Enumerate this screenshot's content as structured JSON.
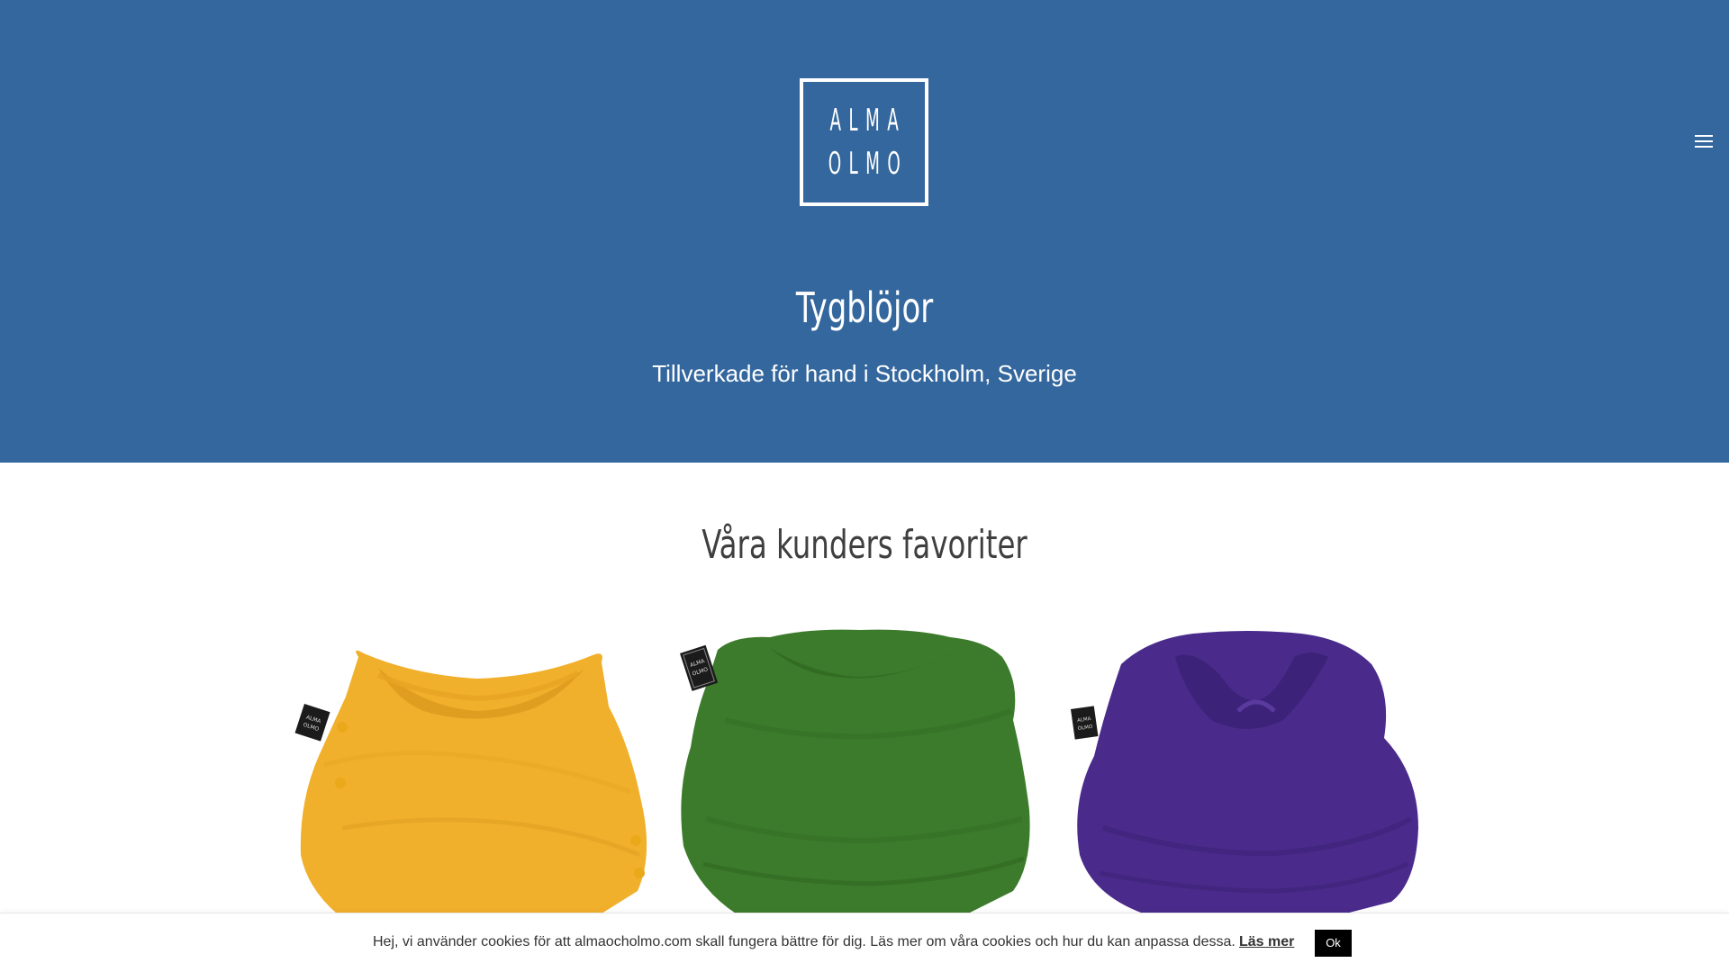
{
  "header": {
    "logo": {
      "line1": "ALMA",
      "line2": "OLMO"
    },
    "menu_icon": "hamburger-menu-icon",
    "title": "Tygblöjor",
    "subtitle": "Tillverkade för hand i Stockholm, Sverige",
    "background_color": "#34679d"
  },
  "favorites": {
    "title": "Våra kunders favoriter",
    "products": [
      {
        "color_name": "yellow",
        "color": "#f2b32a"
      },
      {
        "color_name": "green",
        "color": "#3b7a2a"
      },
      {
        "color_name": "purple",
        "color": "#4b2a8a"
      }
    ]
  },
  "cookie_bar": {
    "text": "Hej, vi använder cookies för att almaocholmo.com skall fungera bättre för dig. Läs mer om våra cookies och hur du kan anpassa dessa.",
    "read_more_label": "Läs mer",
    "ok_label": "Ok"
  }
}
